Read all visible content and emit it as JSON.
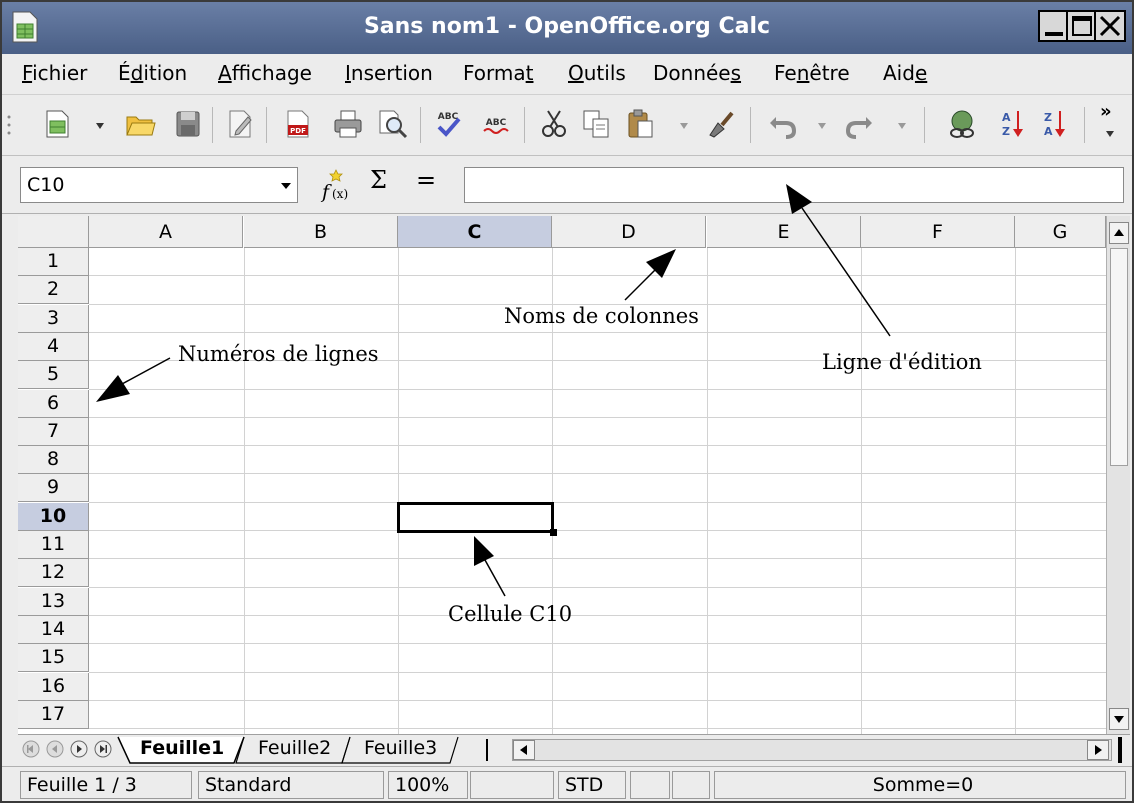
{
  "window": {
    "title": "Sans nom1 - OpenOffice.org Calc"
  },
  "menu": [
    {
      "label": "Fichier",
      "key_index": 0
    },
    {
      "label": "Édition",
      "key_index": 1
    },
    {
      "label": "Affichage",
      "key_index": 0
    },
    {
      "label": "Insertion",
      "key_index": 0
    },
    {
      "label": "Format",
      "key_index": 5
    },
    {
      "label": "Outils",
      "key_index": 0
    },
    {
      "label": "Données",
      "key_index": 6
    },
    {
      "label": "Fenêtre",
      "key_index": 2
    },
    {
      "label": "Aide",
      "key_index": 3
    }
  ],
  "toolbar": {
    "overflow_label": "»"
  },
  "formula_bar": {
    "name_box": "C10",
    "formula_value": "",
    "sigma": "Σ",
    "equals": "="
  },
  "grid": {
    "columns": [
      "A",
      "B",
      "C",
      "D",
      "E",
      "F",
      "G"
    ],
    "rows": [
      "1",
      "2",
      "3",
      "4",
      "5",
      "6",
      "7",
      "8",
      "9",
      "10",
      "11",
      "12",
      "13",
      "14",
      "15",
      "16",
      "17"
    ],
    "selected_column": "C",
    "selected_row": "10"
  },
  "sheet_tabs": [
    {
      "label": "Feuille1",
      "active": true
    },
    {
      "label": "Feuille2",
      "active": false
    },
    {
      "label": "Feuille3",
      "active": false
    }
  ],
  "status_bar": {
    "sheet_position": "Feuille 1 / 3",
    "page_style": "Standard",
    "zoom": "100%",
    "mode": "STD",
    "sum": "Somme=0"
  },
  "annotations": {
    "row_numbers": "Numéros de lignes",
    "column_names": "Noms de colonnes",
    "edit_line": "Ligne d'édition",
    "cell": "Cellule C10"
  }
}
